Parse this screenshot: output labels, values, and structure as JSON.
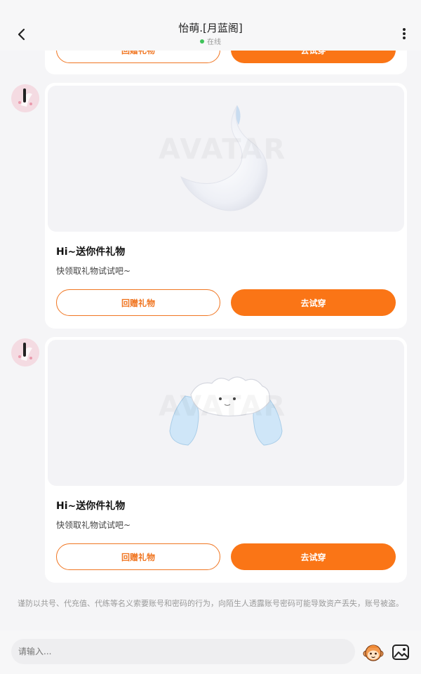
{
  "header": {
    "title": "怡萌.[月蓝阁]",
    "status": "在线",
    "status_color": "#3fc35a"
  },
  "messages": [
    {
      "title": "Hi~送你件礼物",
      "subtitle": "快领取礼物试试吧~",
      "gift_back": "回赠礼物",
      "try_on": "去试穿",
      "image": "tail-item"
    },
    {
      "title": "Hi~送你件礼物",
      "subtitle": "快领取礼物试试吧~",
      "gift_back": "回赠礼物",
      "try_on": "去试穿",
      "image": "headband-item"
    }
  ],
  "partial_card": {
    "gift_back": "回赠礼物",
    "try_on": "去试穿"
  },
  "warning": "谨防以共号、代充值、代练等名义索要账号和密码的行为，向陌生人透露账号密码可能导致资产丢失，账号被盗。",
  "composer": {
    "placeholder": "请输入..."
  },
  "colors": {
    "accent": "#fa7516",
    "background": "#f5f5f7"
  }
}
